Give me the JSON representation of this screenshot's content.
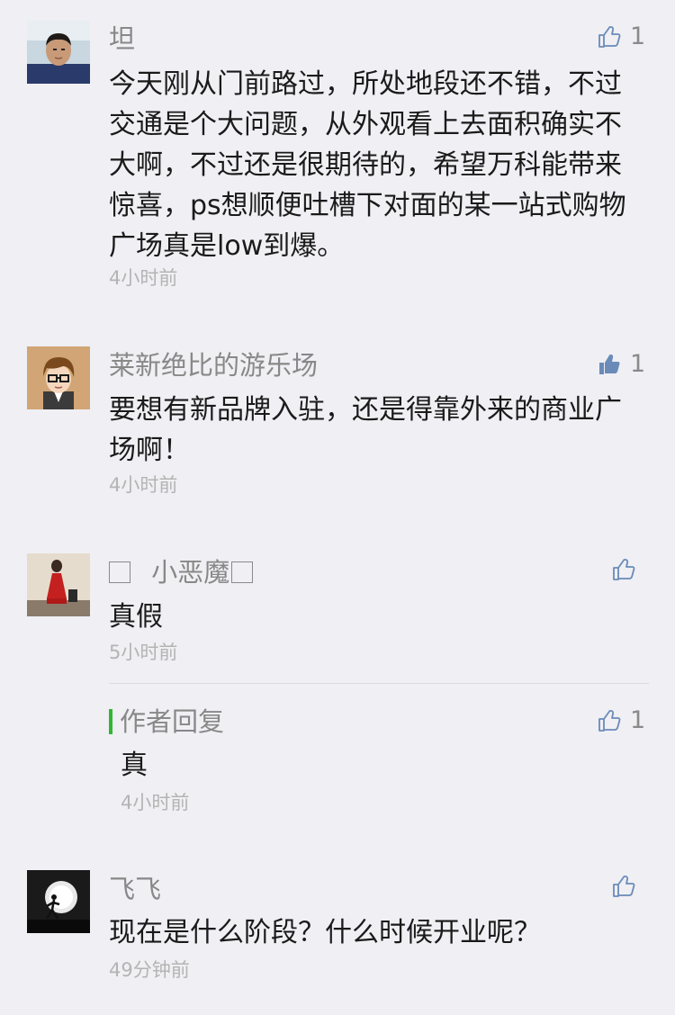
{
  "comments": [
    {
      "name": "坦",
      "text": "今天刚从门前路过，所处地段还不错，不过交通是个大问题，从外观看上去面积确实不大啊，不过还是很期待的，希望万科能带来惊喜，ps想顺便吐槽下对面的某一站式购物广场真是low到爆。",
      "time": "4小时前",
      "likes": "1",
      "liked": false
    },
    {
      "name": "莱新绝比的游乐场",
      "text": "要想有新品牌入驻，还是得靠外来的商业广场啊！",
      "time": "4小时前",
      "likes": "1",
      "liked": true
    },
    {
      "name": "小恶魔",
      "text": "真假",
      "time": "5小时前",
      "likes": "",
      "liked": false,
      "reply": {
        "label": "作者回复",
        "text": "真",
        "time": "4小时前",
        "likes": "1"
      }
    },
    {
      "name": "飞飞",
      "text": "现在是什么阶段？什么时候开业呢？",
      "time": "49分钟前",
      "likes": "",
      "liked": false
    }
  ],
  "colors": {
    "background": "#efeff4",
    "name": "#888888",
    "text": "#1a1a1a",
    "time": "#b4b4b4",
    "reply_accent": "#2fb82f"
  },
  "icons": [
    "thumbs-up-icon",
    "thumbs-up-filled-icon"
  ]
}
